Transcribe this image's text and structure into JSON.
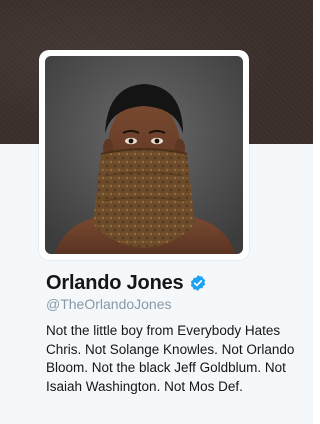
{
  "profile": {
    "display_name": "Orlando Jones",
    "screen_name": "@TheOrlandoJones",
    "verified": true,
    "bio": "Not the little boy from Everybody Hates Chris. Not Solange Knowles. Not Orlando Bloom. Not the black Jeff Goldblum. Not Isaiah Washington. Not Mos Def."
  },
  "icons": {
    "verified": "verified-badge-icon"
  },
  "colors": {
    "header_banner": "#3a2f2b",
    "card_background": "#f5f8fa",
    "name_text": "#14171a",
    "screen_name_text": "#8899a6",
    "verified_badge": "#1da1f2"
  }
}
